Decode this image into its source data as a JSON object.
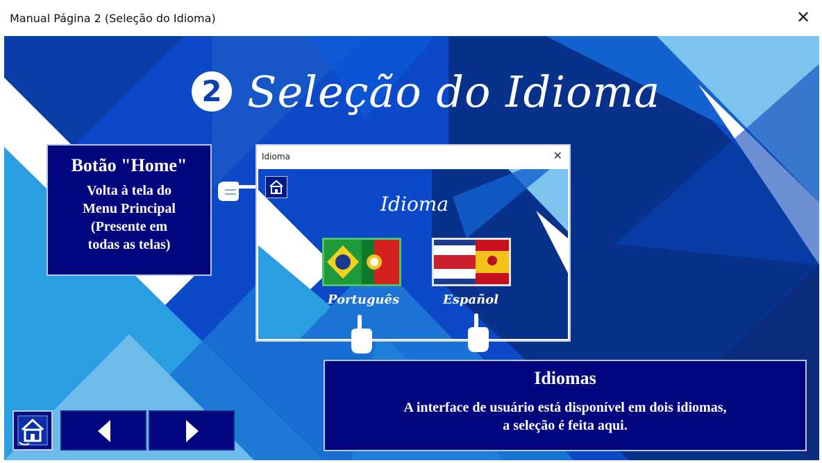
{
  "window": {
    "title": "Manual Página 2 (Seleção do Idioma)",
    "close_glyph": "✕"
  },
  "slide": {
    "step_number": "2",
    "title": "Seleção do Idioma"
  },
  "home_callout": {
    "heading": "Botão \"Home\"",
    "lines": [
      "Volta à tela do",
      "Menu Principal",
      "(Presente em",
      "todas as telas)"
    ]
  },
  "language_dialog": {
    "title": "Idioma",
    "close_glyph": "✕",
    "heading": "Idioma",
    "options": [
      {
        "label": "Português",
        "flag": "brazil-portugal-flag"
      },
      {
        "label": "Español",
        "flag": "costa-rica-spain-flag"
      }
    ]
  },
  "language_callout": {
    "heading": "Idiomas",
    "lines": [
      "A interface de usuário está disponível em dois idiomas,",
      "a seleção é feita aqui."
    ]
  },
  "navigation": {
    "home_icon": "home-icon",
    "prev_icon": "triangle-left-icon",
    "next_icon": "triangle-right-icon"
  },
  "colors": {
    "navy_panel": "#02067e",
    "background_blue": "#0b49c8",
    "light_blue": "#7cc4ee",
    "selected_border": "#4dc36a"
  }
}
